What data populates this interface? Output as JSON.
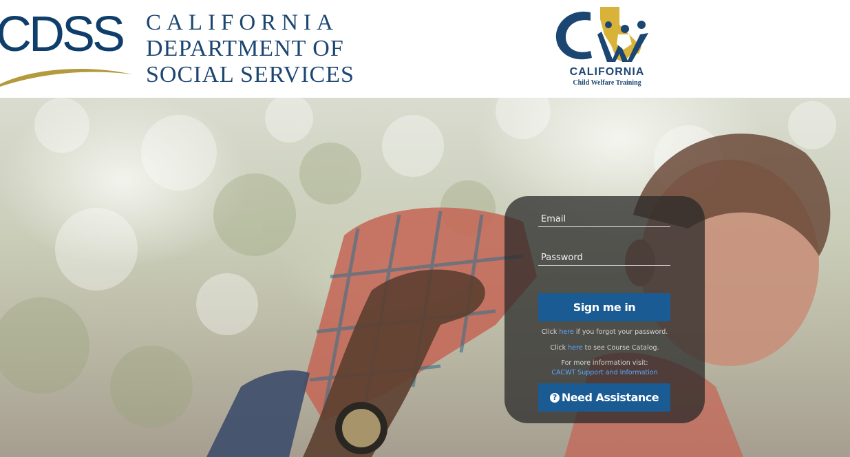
{
  "header": {
    "cdss_logo": {
      "mark": "CDSS",
      "line1": "CALIFORNIA",
      "line2": "DEPARTMENT OF",
      "line3": "SOCIAL SERVICES"
    },
    "cwt_logo": {
      "title": "CALIFORNIA",
      "subtitle": "Child Welfare Training"
    }
  },
  "login": {
    "email_placeholder": "Email",
    "password_placeholder": "Password",
    "sign_in_label": "Sign me in",
    "forgot": {
      "prefix": "Click ",
      "link": "here",
      "suffix": " if you forgot your password."
    },
    "catalog": {
      "prefix": "Click ",
      "link": "here",
      "suffix": " to see Course Catalog."
    },
    "more_info": {
      "text": "For more information visit:",
      "link": "CACWT Support and Information"
    },
    "assistance_label": "Need Assistance",
    "assistance_icon": "question-circle-icon"
  },
  "colors": {
    "brand_navy": "#1c4672",
    "button_blue": "#1b5b94",
    "gold": "#b39a3e",
    "link": "#5aa9ff"
  }
}
